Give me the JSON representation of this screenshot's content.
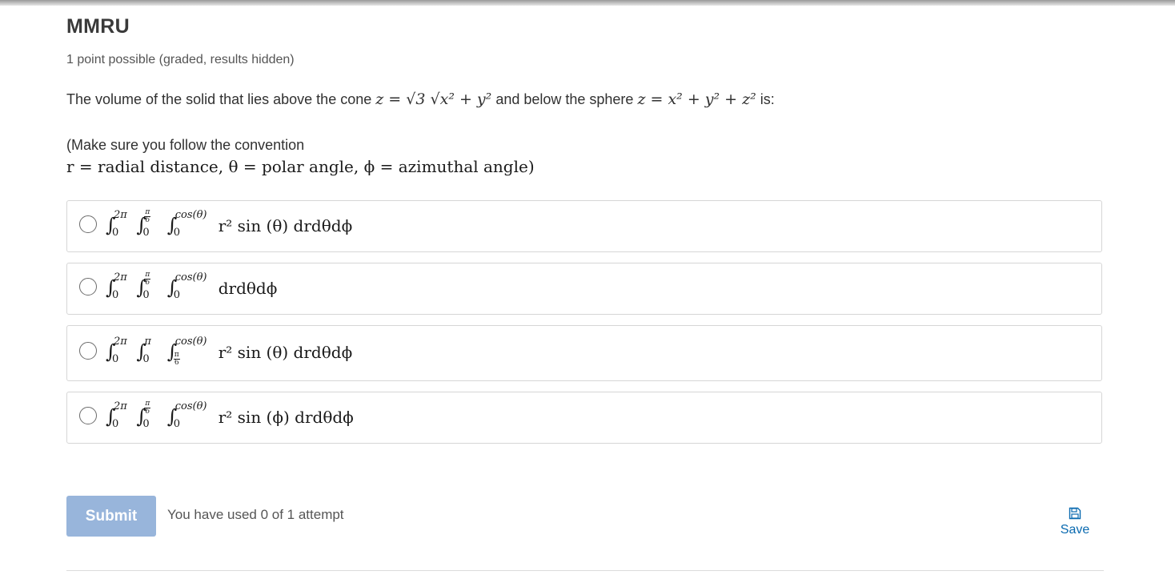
{
  "problem": {
    "title": "MMRU",
    "points_text": "1 point possible (graded, results hidden)",
    "question_lead": "The volume of the solid that lies above the cone",
    "cone_eq": "z = √3 √x² + y²",
    "question_mid": "and below the sphere",
    "sphere_eq": "z = x² + y² + z²",
    "question_tail": "is:",
    "convention_lead": "(Make sure you follow the convention",
    "convention_math": "r = radial distance, θ = polar angle, ϕ = azimuthal angle)"
  },
  "options": [
    {
      "outer_upper": "2π",
      "outer_lower": "0",
      "mid_upper_n": "π",
      "mid_upper_d": "6",
      "mid_lower": "0",
      "inner_upper": "cos(θ)",
      "inner_lower": "0",
      "integrand": "r² sin (θ) drdθdϕ"
    },
    {
      "outer_upper": "2π",
      "outer_lower": "0",
      "mid_upper_n": "π",
      "mid_upper_d": "6",
      "mid_lower": "0",
      "inner_upper": "cos(θ)",
      "inner_lower": "0",
      "integrand": "drdθdϕ"
    },
    {
      "outer_upper": "2π",
      "outer_lower": "0",
      "mid_upper": "π",
      "mid_lower": "0",
      "inner_upper": "cos(θ)",
      "inner_lower_n": "π",
      "inner_lower_d": "6",
      "integrand": "r² sin (θ) drdθdϕ"
    },
    {
      "outer_upper": "2π",
      "outer_lower": "0",
      "mid_upper_n": "π",
      "mid_upper_d": "6",
      "mid_lower": "0",
      "inner_upper": "cos(θ)",
      "inner_lower": "0",
      "integrand": "r² sin (ϕ) drdθdϕ"
    }
  ],
  "actions": {
    "submit_label": "Submit",
    "attempts_text": "You have used 0 of 1 attempt",
    "save_label": "Save"
  },
  "colors": {
    "submit_bg": "#98b5db",
    "link": "#0a6ab0"
  }
}
